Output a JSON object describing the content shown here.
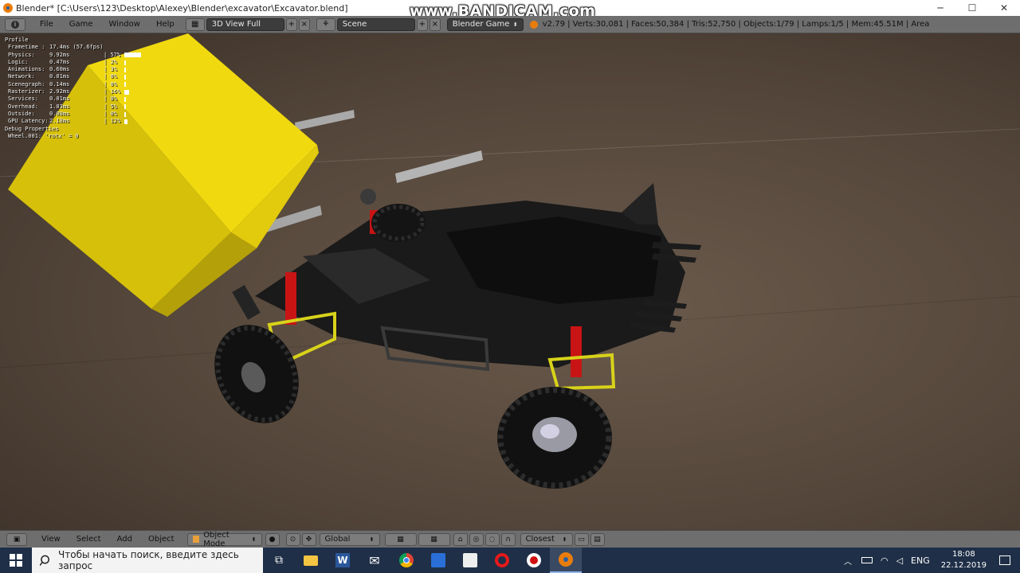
{
  "titlebar": {
    "title": "Blender* [C:\\Users\\123\\Desktop\\Alexey\\Blender\\excavator\\Excavator.blend]",
    "minimize": "─",
    "maximize": "☐",
    "close": "✕"
  },
  "watermark": "www.BANDICAM.com",
  "info_header": {
    "menus": [
      "File",
      "Game",
      "Window",
      "Help"
    ],
    "screen_layout": "3D View Full",
    "scene": "Scene",
    "engine": "Blender Game",
    "stats": "v2.79 | Verts:30,081 | Faces:50,384 | Tris:52,750 | Objects:1/79 | Lamps:1/5 | Mem:45.51M | Area"
  },
  "profile": {
    "heading": "Profile",
    "rows": [
      {
        "label": "Frametime :",
        "value": "17.4ms (57.6fps)",
        "pct": "",
        "fraction": 0
      },
      {
        "label": "Physics:",
        "value": "9.92ms",
        "pct": "57%",
        "fraction": 0.57
      },
      {
        "label": "Logic:",
        "value": "0.47ms",
        "pct": "2%",
        "fraction": 0.02
      },
      {
        "label": "Animations:",
        "value": "0.60ms",
        "pct": "3%",
        "fraction": 0.03
      },
      {
        "label": "Network:",
        "value": "0.01ms",
        "pct": "0%",
        "fraction": 0.0
      },
      {
        "label": "Scenegraph:",
        "value": "0.14ms",
        "pct": "0%",
        "fraction": 0.0
      },
      {
        "label": "Rasterizer:",
        "value": "2.92ms",
        "pct": "16%",
        "fraction": 0.16
      },
      {
        "label": "Services:",
        "value": "0.01ms",
        "pct": "0%",
        "fraction": 0.0
      },
      {
        "label": "Overhead:",
        "value": "1.03ms",
        "pct": "5%",
        "fraction": 0.05
      },
      {
        "label": "Outside:",
        "value": "0.00ms",
        "pct": "0%",
        "fraction": 0.0
      },
      {
        "label": "GPU Latency:",
        "value": "2.18ms",
        "pct": "12%",
        "fraction": 0.12
      }
    ],
    "debug_heading": "Debug Properties",
    "debug_line": "Wheel.001: 'rotx' = 0"
  },
  "view_header": {
    "menus": [
      "View",
      "Select",
      "Add",
      "Object"
    ],
    "mode": "Object Mode",
    "orientation": "Global",
    "snap": "Closest"
  },
  "taskbar": {
    "search_placeholder": "Чтобы начать поиск, введите здесь запрос",
    "language": "ENG",
    "time": "18:08",
    "date": "22.12.2019"
  },
  "colors": {
    "blender_header": "#6e6e6e",
    "bucket_yellow": "#e8d20a",
    "suspension_red": "#c81414",
    "taskbar": "#1f2f47"
  }
}
